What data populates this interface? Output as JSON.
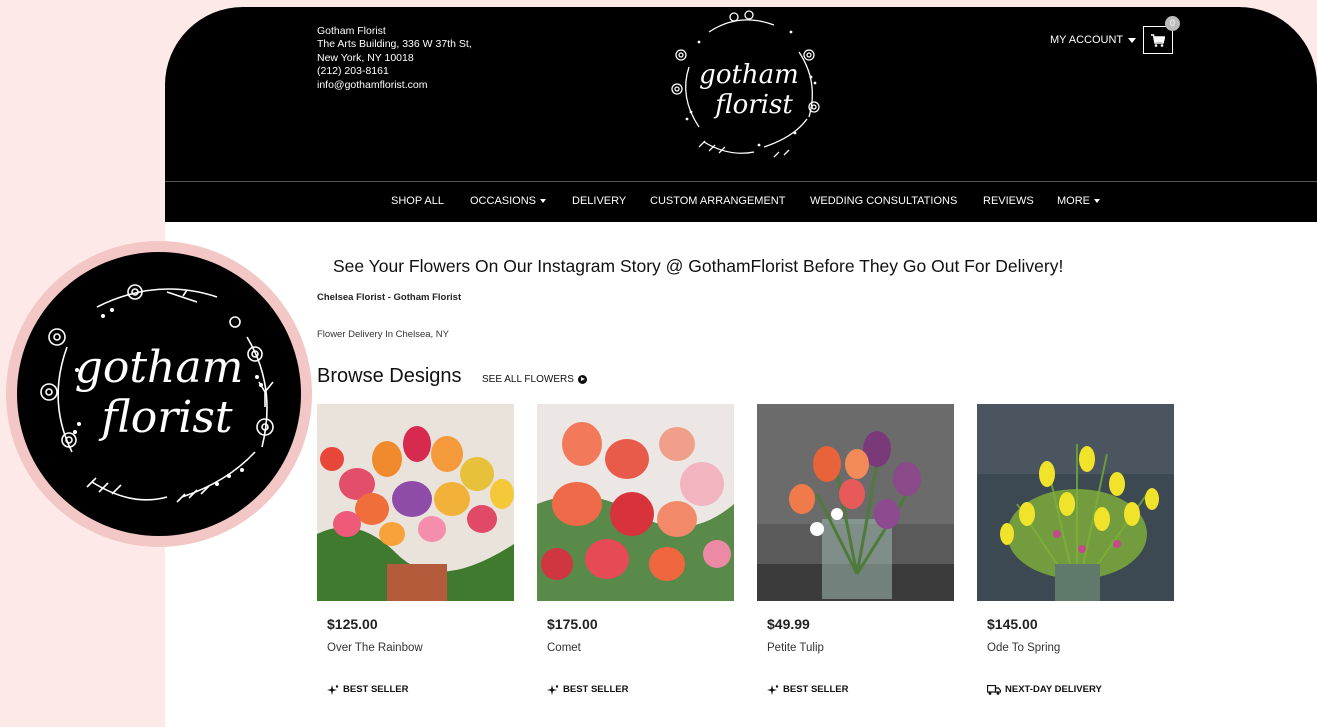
{
  "colors": {
    "background": "#fde9e8",
    "header": "#000000",
    "window": "#ffffff",
    "logo_ring": "#f3c7c5"
  },
  "logo": {
    "line1": "gotham",
    "line2": "florist"
  },
  "store": {
    "name": "Gotham Florist",
    "address1": "The Arts Building, 336 W 37th St,",
    "address2": "New York, NY 10018",
    "phone": "(212) 203-8161",
    "email": "info@gothamflorist.com"
  },
  "account": {
    "label": "MY ACCOUNT",
    "cart_count": "0",
    "cart_icon": "shopping-cart-icon"
  },
  "nav": [
    {
      "label": "SHOP ALL",
      "dropdown": false
    },
    {
      "label": "OCCASIONS",
      "dropdown": true
    },
    {
      "label": "DELIVERY",
      "dropdown": false
    },
    {
      "label": "CUSTOM ARRANGEMENT",
      "dropdown": false
    },
    {
      "label": "WEDDING CONSULTATIONS",
      "dropdown": false
    },
    {
      "label": "REVIEWS",
      "dropdown": false
    },
    {
      "label": "MORE",
      "dropdown": true
    }
  ],
  "main": {
    "headline": "See Your Flowers On Our Instagram Story @ GothamFlorist Before They Go Out For Delivery!",
    "subline1": "Chelsea Florist - Gotham Florist",
    "subline2": "Flower Delivery In Chelsea, NY",
    "browse_title": "Browse Designs",
    "see_all": "SEE ALL FLOWERS"
  },
  "products": [
    {
      "price": "$125.00",
      "name": "Over The Rainbow",
      "badge": "BEST SELLER",
      "badge_icon": "sparkle-icon"
    },
    {
      "price": "$175.00",
      "name": "Comet",
      "badge": "BEST SELLER",
      "badge_icon": "sparkle-icon"
    },
    {
      "price": "$49.99",
      "name": "Petite Tulip",
      "badge": "BEST SELLER",
      "badge_icon": "sparkle-icon"
    },
    {
      "price": "$145.00",
      "name": "Ode To Spring",
      "badge": "NEXT-DAY DELIVERY",
      "badge_icon": "delivery-truck-icon"
    }
  ]
}
